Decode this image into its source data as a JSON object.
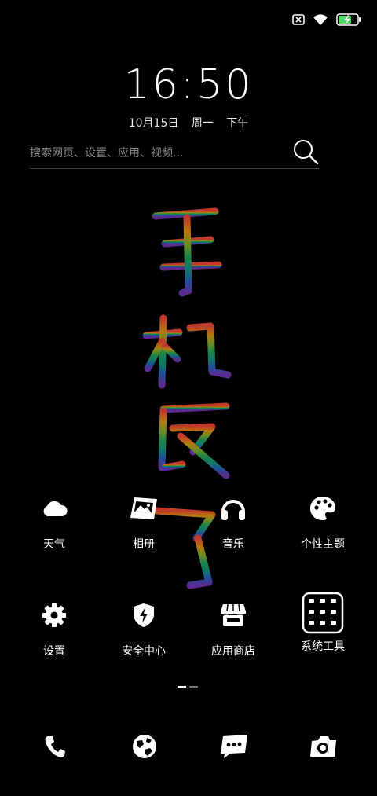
{
  "status_bar": {
    "icons": [
      "sim-blocked-icon",
      "wifi-icon",
      "battery-charging-icon"
    ],
    "battery_color": "#4cd964"
  },
  "lockscreen": {
    "time": "16:50",
    "date": "10月15日",
    "weekday": "周一",
    "period": "下午"
  },
  "search": {
    "placeholder": "搜索网页、设置、应用、视频..."
  },
  "wallpaper": {
    "text": "手机反了",
    "colors": [
      "#c0392b",
      "#b9770e",
      "#6b8e23",
      "#1e8449",
      "#117a65",
      "#1f4e9a",
      "#5b2c8f"
    ]
  },
  "apps": [
    {
      "label": "天气",
      "icon": "cloud-icon"
    },
    {
      "label": "相册",
      "icon": "gallery-icon"
    },
    {
      "label": "音乐",
      "icon": "headphones-icon"
    },
    {
      "label": "个性主题",
      "icon": "palette-icon"
    },
    {
      "label": "设置",
      "icon": "gear-icon"
    },
    {
      "label": "安全中心",
      "icon": "shield-icon"
    },
    {
      "label": "应用商店",
      "icon": "store-icon"
    },
    {
      "label": "系统工具",
      "icon": "folder-icon"
    }
  ],
  "pager": {
    "pages": 2,
    "current": 1
  },
  "dock": [
    {
      "icon": "phone-icon"
    },
    {
      "icon": "browser-icon"
    },
    {
      "icon": "messages-icon"
    },
    {
      "icon": "camera-icon"
    }
  ]
}
